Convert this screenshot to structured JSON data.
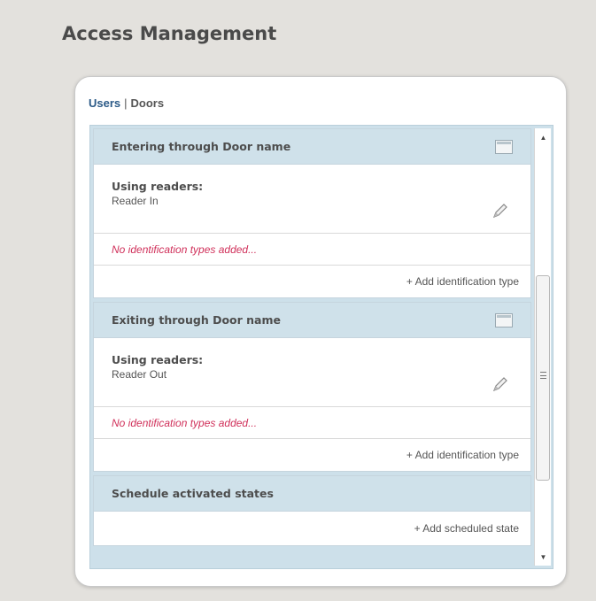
{
  "page": {
    "title": "Access Management"
  },
  "tabs": {
    "users": "Users",
    "separator": "|",
    "doors": "Doors"
  },
  "sections": [
    {
      "header": "Entering through Door name",
      "header_icon": "panel-icon",
      "readers_title": "Using readers:",
      "readers_value": "Reader In",
      "edit_icon": "pencil-icon",
      "empty_text": "No identification types added...",
      "add_label": "+ Add identification type"
    },
    {
      "header": "Exiting through Door name",
      "header_icon": "panel-icon",
      "readers_title": "Using readers:",
      "readers_value": "Reader Out",
      "edit_icon": "pencil-icon",
      "empty_text": "No identification types added...",
      "add_label": "+ Add identification type"
    },
    {
      "header": "Schedule activated states",
      "add_label": "+ Add scheduled state"
    }
  ],
  "scrollbar": {
    "up_icon": "triangle-up-icon",
    "down_icon": "triangle-down-icon"
  },
  "colors": {
    "header_bg": "#cfe1ea",
    "link": "#2b5a87",
    "warning_text": "#d0305a"
  }
}
